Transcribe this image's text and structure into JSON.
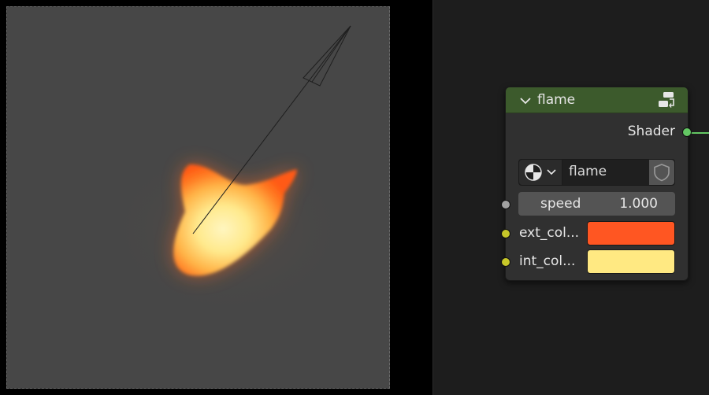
{
  "viewport": {
    "fill_color": "#474747",
    "flame_colors": [
      "#ff5a14",
      "#ffa640",
      "#ffe98c"
    ]
  },
  "node": {
    "title": "flame",
    "header_color": "#3c5a2c",
    "collapse_icon": "chevron-down-icon",
    "group_icon": "node-group-icon",
    "output": {
      "label": "Shader",
      "socket_color": "#63c763"
    },
    "datablock": {
      "name": "flame",
      "browse_icon": "node-tree-icon",
      "fake_user_icon": "shield-icon"
    },
    "inputs": {
      "speed": {
        "label": "speed",
        "value": "1.000",
        "socket_color": "#a1a1a1"
      },
      "ext_color": {
        "label": "ext_col...",
        "color": "#ff5622",
        "socket_color": "#c7c729"
      },
      "int_color": {
        "label": "int_col...",
        "color": "#ffe982",
        "socket_color": "#c7c729"
      }
    }
  }
}
